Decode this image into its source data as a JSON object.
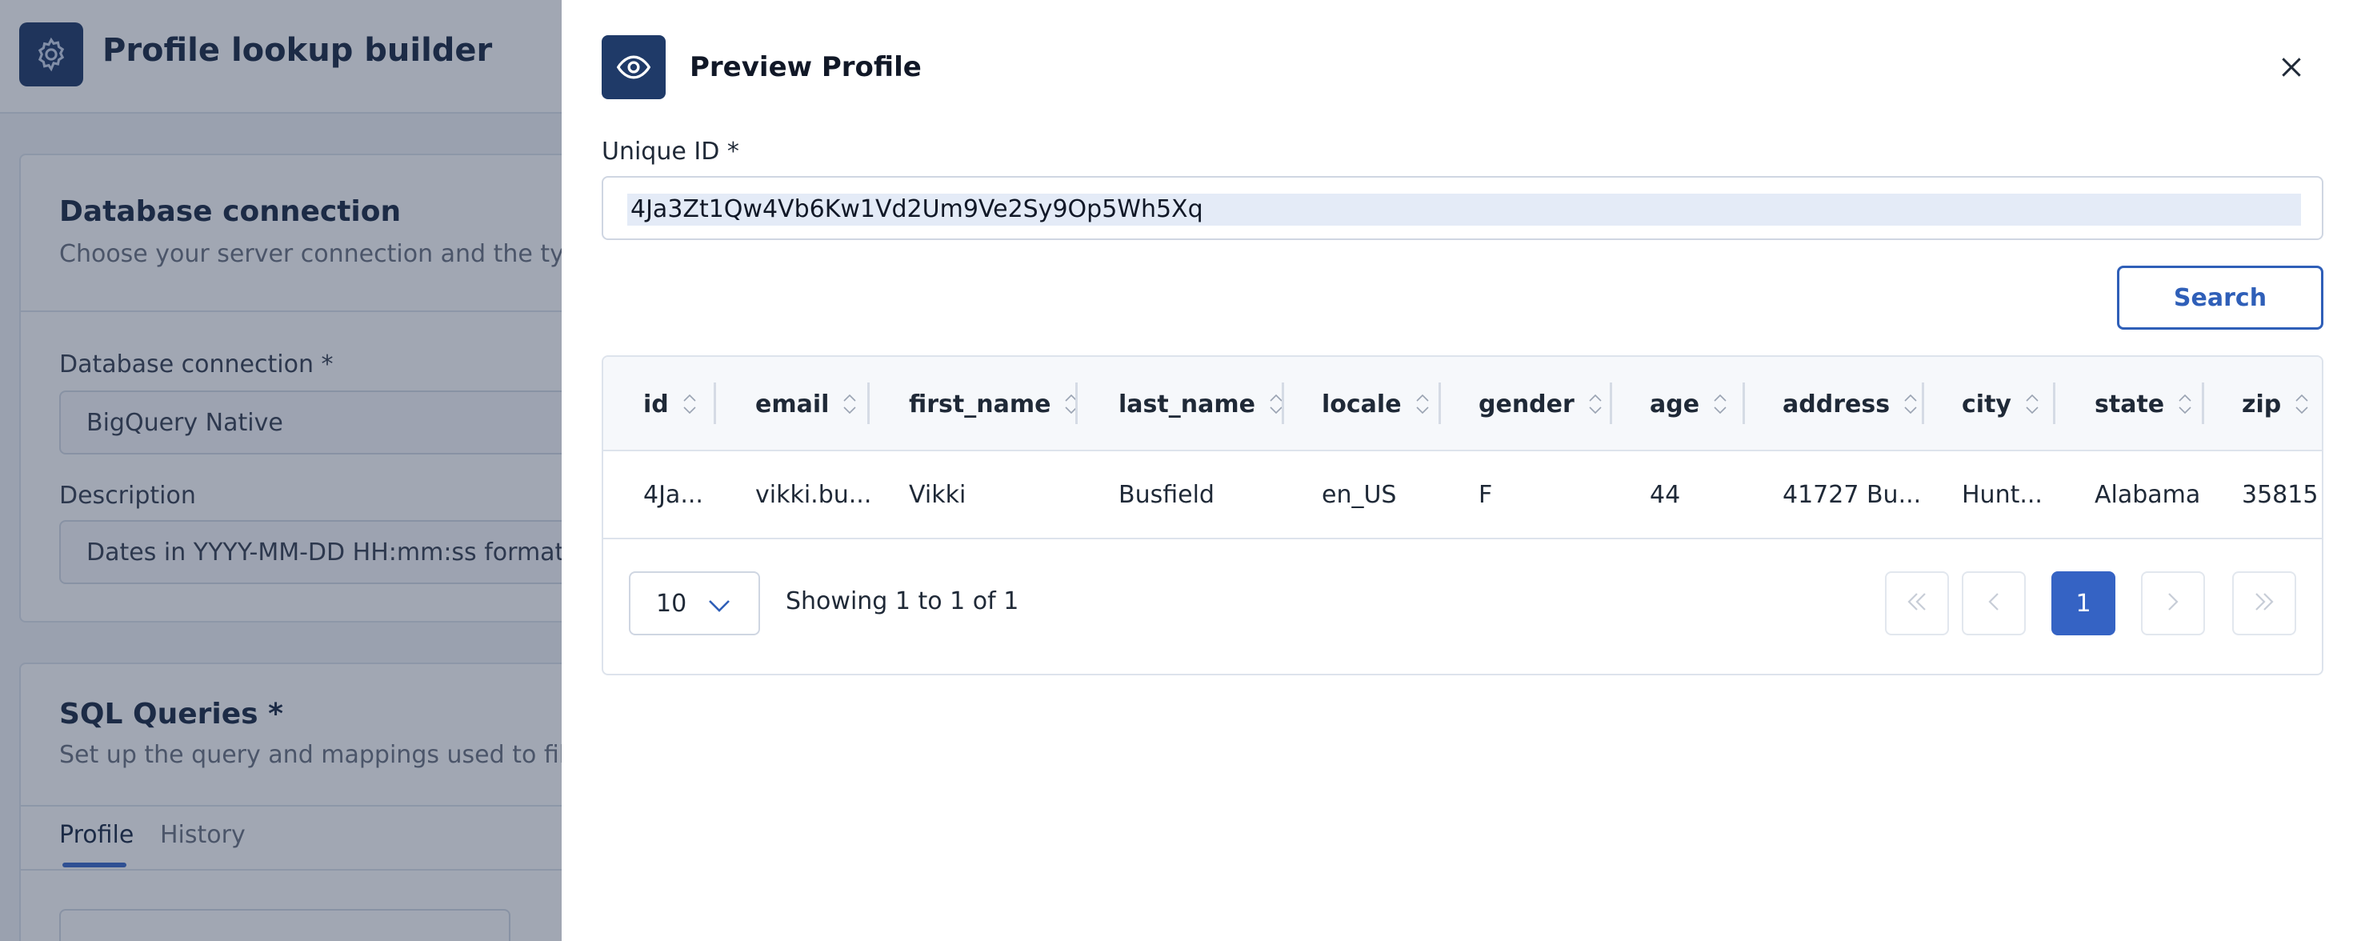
{
  "app": {
    "title": "Profile lookup builder"
  },
  "database_section": {
    "title": "Database connection",
    "subtitle": "Choose your server connection and the type of d",
    "connection_label": "Database connection *",
    "connection_value": "BigQuery Native",
    "description_label": "Description",
    "description_value": "Dates in YYYY-MM-DD HH:mm:ss format. And"
  },
  "sql_section": {
    "title": "SQL Queries *",
    "subtitle": "Set up the query and mappings used to fill the p",
    "tabs": [
      {
        "label": "Profile",
        "active": true
      },
      {
        "label": "History",
        "active": false
      }
    ]
  },
  "drawer": {
    "title": "Preview Profile",
    "title_icon": "eye-icon",
    "close_icon": "close-icon",
    "unique_id_label": "Unique ID *",
    "unique_id_value": "4Ja3Zt1Qw4Vb6Kw1Vd2Um9Ve2Sy9Op5Wh5Xq",
    "search_label": "Search",
    "table": {
      "columns": [
        "id",
        "email",
        "first_name",
        "last_name",
        "locale",
        "gender",
        "age",
        "address",
        "city",
        "state",
        "zip"
      ],
      "rows": [
        [
          "4Ja...",
          "vikki.bu...",
          "Vikki",
          "Busfield",
          "en_US",
          "F",
          "44",
          "41727 Bu...",
          "Hunt...",
          "Alabama",
          "35815"
        ]
      ]
    },
    "pagination": {
      "page_size": "10",
      "showing_text": "Showing 1 to 1 of 1",
      "current_page": "1"
    }
  },
  "colors": {
    "primary": "#2f5fb8",
    "header_dark": "#1f3a68"
  }
}
